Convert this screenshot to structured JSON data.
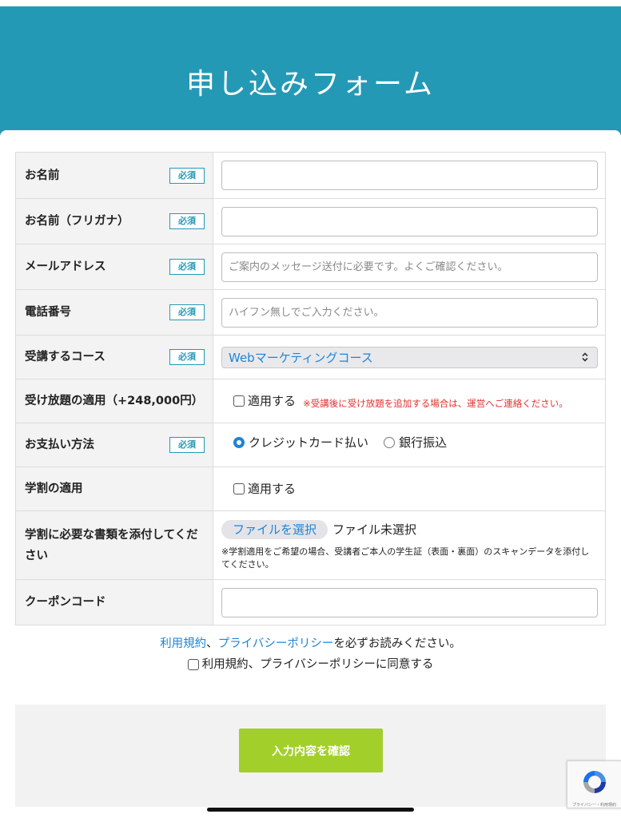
{
  "header": {
    "title": "申し込みフォーム"
  },
  "required_label": "必須",
  "fields": {
    "name": {
      "label": "お名前",
      "value": "",
      "placeholder": ""
    },
    "kana": {
      "label": "お名前（フリガナ）",
      "value": "",
      "placeholder": ""
    },
    "email": {
      "label": "メールアドレス",
      "value": "",
      "placeholder": "ご案内のメッセージ送付に必要です。よくご確認ください。"
    },
    "phone": {
      "label": "電話番号",
      "value": "",
      "placeholder": "ハイフン無しでご入力ください。"
    },
    "course": {
      "label": "受講するコース",
      "selected": "Webマーケティングコース"
    },
    "unlimited": {
      "label": "受け放題の適用（+248,000円）",
      "checkbox_label": "適用する",
      "note": "※受講後に受け放題を追加する場合は、運営へご連絡ください。"
    },
    "payment": {
      "label": "お支払い方法",
      "options": [
        "クレジットカード払い",
        "銀行振込"
      ],
      "selected_index": 0
    },
    "student_discount": {
      "label": "学割の適用",
      "checkbox_label": "適用する"
    },
    "student_docs": {
      "label": "学割に必要な書類を添付してください",
      "button_label": "ファイルを選択",
      "status": "ファイル未選択",
      "note": "※学割適用をご希望の場合、受講者ご本人の学生証（表面・裏面）のスキャンデータを添付してください。"
    },
    "coupon": {
      "label": "クーポンコード",
      "value": "",
      "placeholder": ""
    }
  },
  "terms": {
    "terms_link": "利用規約",
    "separator": "、",
    "privacy_link": "プライバシーポリシー",
    "suffix": "を必ずお読みください。",
    "agree_label": "利用規約、プライバシーポリシーに同意する"
  },
  "submit": {
    "label": "入力内容を確認"
  },
  "recaptcha": {
    "text": "プライバシー・利用規約"
  },
  "colors": {
    "header": "#2499b5",
    "accent": "#1f84d6",
    "submit": "#a3cf2a",
    "warning": "#e0312f"
  }
}
